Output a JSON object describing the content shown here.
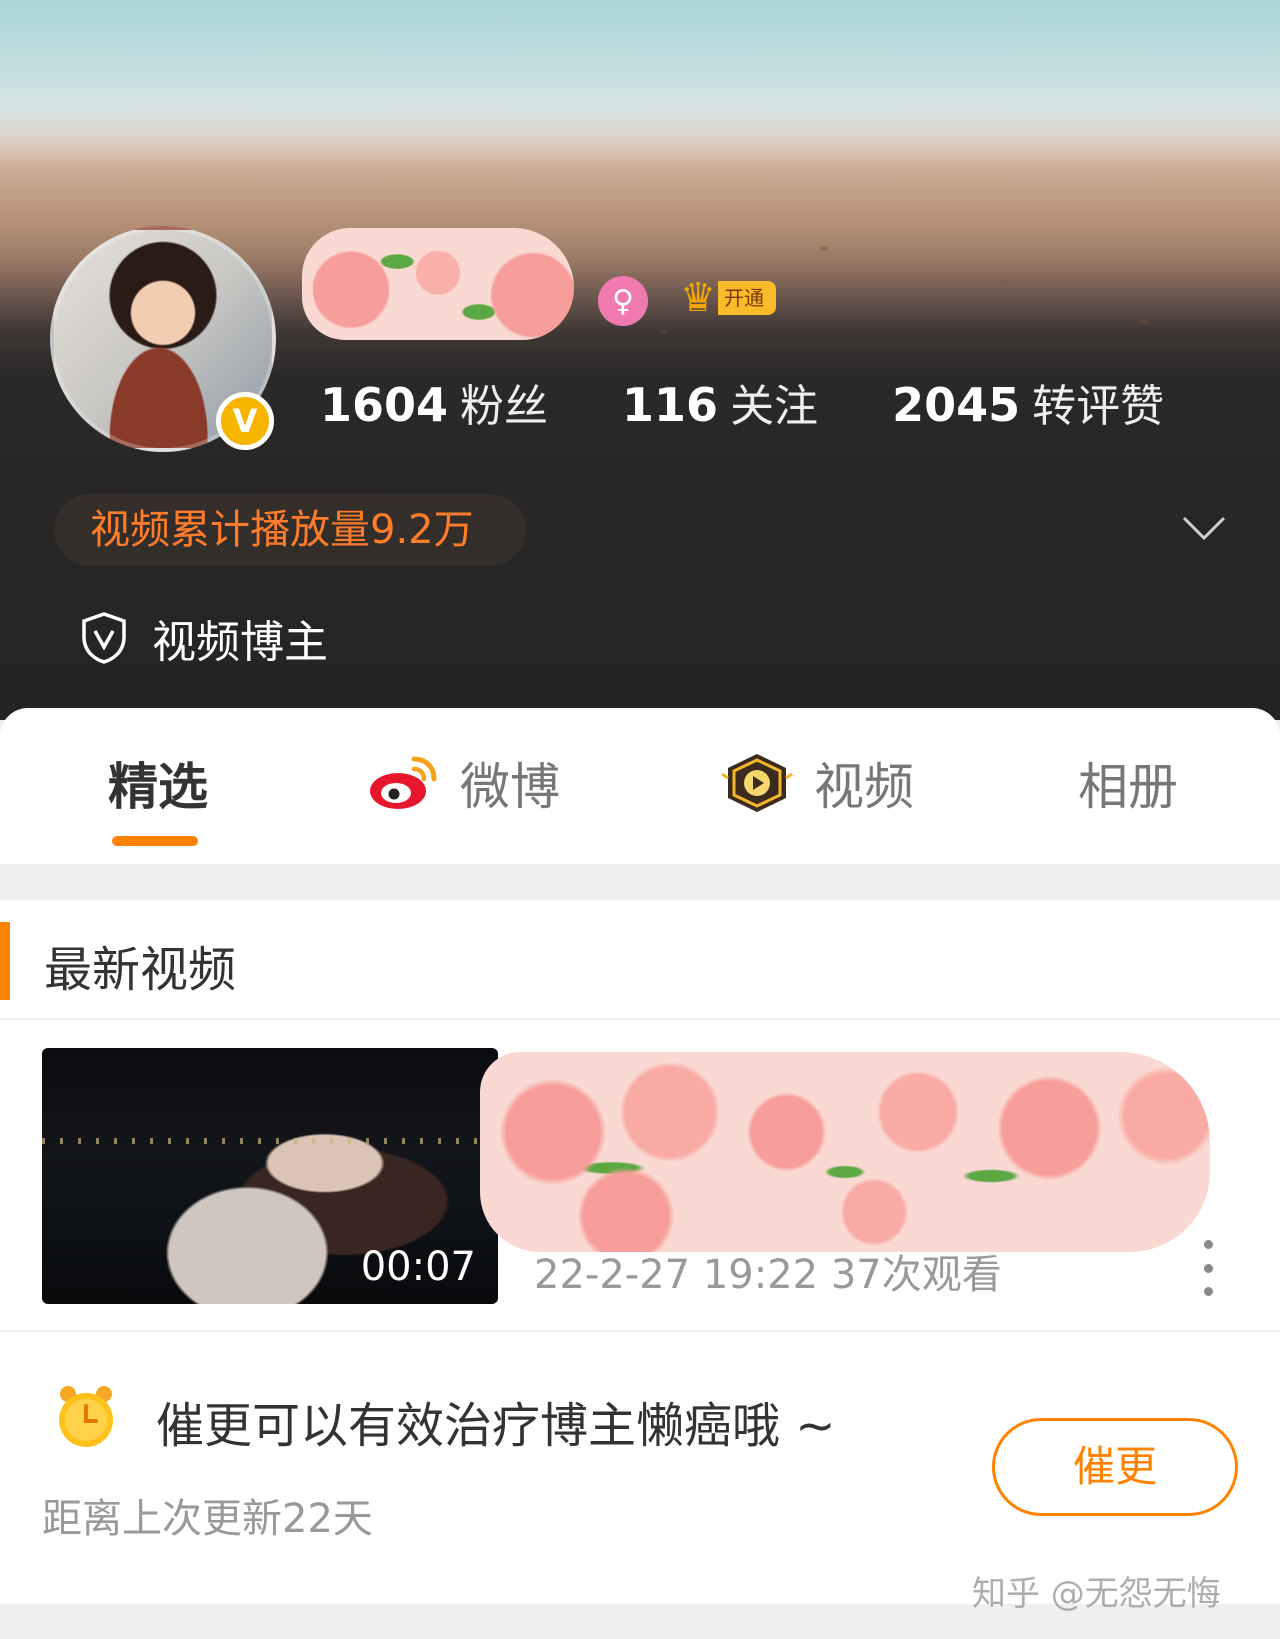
{
  "profile": {
    "verified_badge": "V",
    "gender_icon": "female-icon",
    "gender_symbol": "♀",
    "vip_label": "开通",
    "stats": [
      {
        "value": "1604",
        "label": "粉丝"
      },
      {
        "value": "116",
        "label": "关注"
      },
      {
        "value": "2045",
        "label": "转评赞"
      }
    ],
    "play_count": "视频累计播放量9.2万",
    "role": "视频博主"
  },
  "tabs": [
    {
      "label": "精选",
      "active": true
    },
    {
      "label": "微博",
      "icon": "weibo-icon"
    },
    {
      "label": "视频",
      "icon": "video-icon"
    },
    {
      "label": "相册"
    }
  ],
  "latest": {
    "section_title": "最新视频",
    "video": {
      "duration": "00:07",
      "meta": "22-2-27 19:22 37次观看"
    }
  },
  "urge": {
    "text": "催更可以有效治疗博主懒癌哦 ~",
    "sub": "距离上次更新22天",
    "button": "催更"
  },
  "watermark": "知乎 @无怨无悔",
  "colors": {
    "accent": "#ff8200",
    "play_count": "#ff7d2a",
    "verified": "#f7b500",
    "female": "#f07ab0"
  }
}
